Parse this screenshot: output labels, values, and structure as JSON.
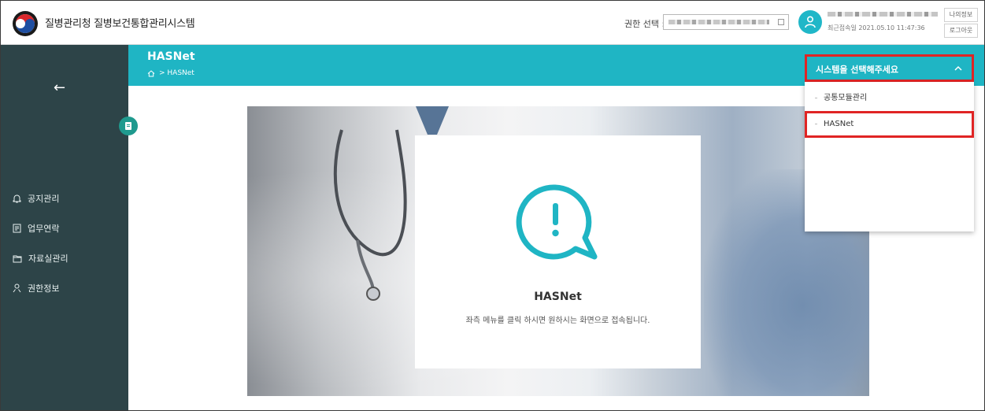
{
  "header": {
    "app_title": "질병관리청 질병보건통합관리시스템",
    "role_label": "권한 선택 :",
    "last_login": "최근접속일 2021.05.10 11:47:36",
    "my_info_label": "나의정보",
    "logout_label": "로그아웃"
  },
  "sidebar": {
    "items": [
      {
        "label": "공지관리",
        "icon": "bell-icon"
      },
      {
        "label": "업무연락",
        "icon": "document-icon"
      },
      {
        "label": "자료실관리",
        "icon": "folder-icon"
      },
      {
        "label": "권한정보",
        "icon": "person-icon"
      }
    ]
  },
  "content": {
    "title": "HASNet",
    "breadcrumb": ">  HASNet",
    "card_title": "HASNet",
    "card_description": "좌측 메뉴를 클릭 하시면 원하시는 화면으로 접속됩니다."
  },
  "system_dropdown": {
    "placeholder": "시스템을 선택해주세요",
    "options": [
      "공통모듈관리",
      "HASNet"
    ]
  },
  "colors": {
    "accent": "#1fb5c4",
    "sidebar": "#2d4448",
    "highlight": "#e02424"
  }
}
